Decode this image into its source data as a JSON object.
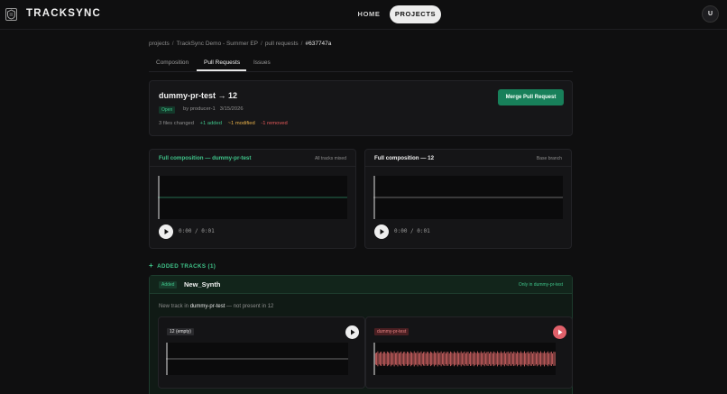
{
  "app": {
    "brand": "TRACKSYNC",
    "nav": [
      {
        "label": "HOME"
      },
      {
        "label": "PROJECTS"
      }
    ],
    "avatar_initial": "U"
  },
  "breadcrumb": [
    "projects",
    "TrackSync Demo - Summer EP",
    "pull requests",
    "#637747a"
  ],
  "tabs": [
    {
      "label": "Composition",
      "active": false
    },
    {
      "label": "Pull Requests",
      "active": true
    },
    {
      "label": "Issues",
      "active": false
    }
  ],
  "pull_request": {
    "title": "dummy-pr-test → 12",
    "status": "Open",
    "author": "by producer-1",
    "date": "3/15/2026",
    "files_changed": "3 files changed",
    "added": "+1 added",
    "modified": "~1 modified",
    "removed": "-1 removed",
    "merge_label": "Merge Pull Request"
  },
  "compositions": [
    {
      "title": "Full composition — dummy-pr-test",
      "tag": "All tracks mixed",
      "time": "0:00 / 0:01"
    },
    {
      "title": "Full composition — 12",
      "tag": "Base branch",
      "time": "0:00 / 0:01"
    }
  ],
  "added_tracks": {
    "heading": "ADDED TRACKS (1)",
    "badge": "Added",
    "track_name": "New_Synth",
    "only_tag": "Only in dummy-pr-test",
    "note_prefix": "New track in",
    "note_branch": "dummy-pr-test",
    "note_suffix": "— not present in 12",
    "left_label": "12 (empty)",
    "right_label": "dummy-pr-test"
  },
  "colors": {
    "accent_green": "#3fc48a",
    "merge_green": "#18805a",
    "modified_amber": "#e8b14a",
    "removed_red": "#e85a5a",
    "waveform_red": "#e06a6a"
  }
}
